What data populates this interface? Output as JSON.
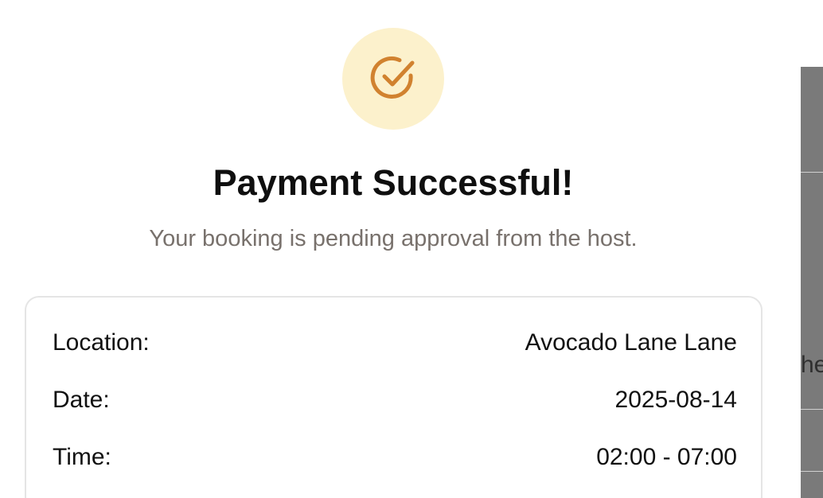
{
  "modal": {
    "icon": "check-circle-icon",
    "title": "Payment Successful!",
    "subtitle": "Your booking is pending approval from the host."
  },
  "details": [
    {
      "label": "Location:",
      "value": "Avocado Lane Lane"
    },
    {
      "label": "Date:",
      "value": "2025-08-14"
    },
    {
      "label": "Time:",
      "value": "02:00 - 07:00"
    }
  ],
  "background": {
    "fragment_text": "he"
  },
  "colors": {
    "accent": "#d1822f",
    "badge_bg": "#fcf1cc",
    "subtitle": "#78716c"
  }
}
